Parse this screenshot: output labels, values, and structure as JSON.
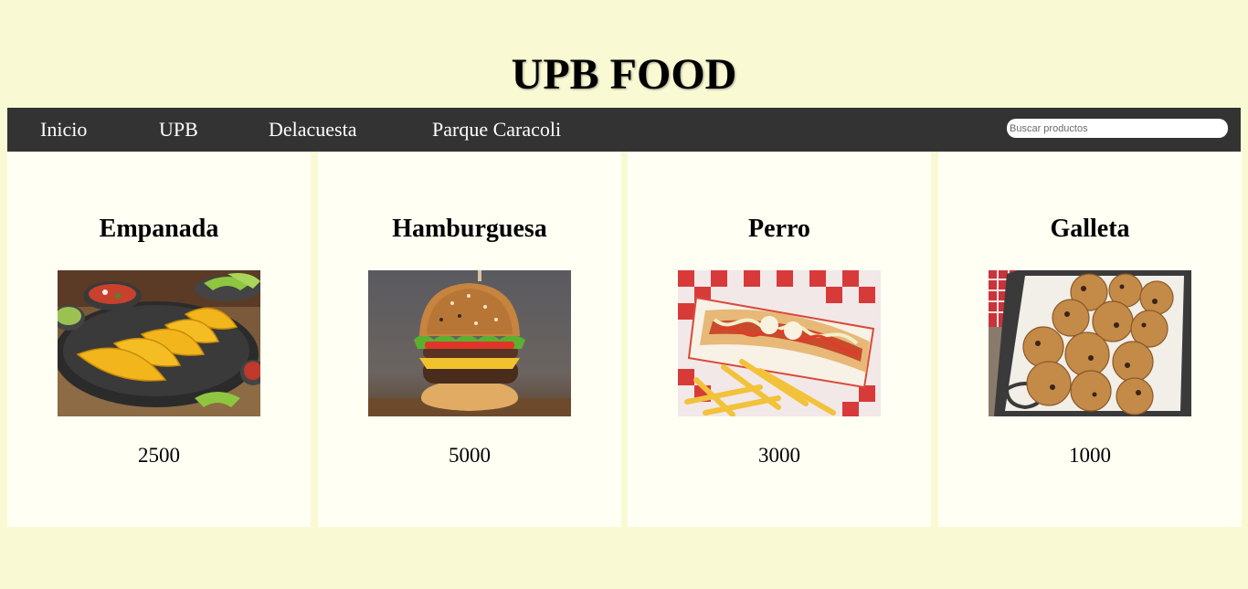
{
  "header": {
    "title": "UPB FOOD"
  },
  "nav": {
    "items": [
      {
        "label": "Inicio"
      },
      {
        "label": "UPB"
      },
      {
        "label": "Delacuesta"
      },
      {
        "label": "Parque Caracoli"
      }
    ],
    "search_placeholder": "Buscar productos",
    "search_value": ""
  },
  "products": [
    {
      "name": "Empanada",
      "price": "2500",
      "image": "empanadas-plate-image"
    },
    {
      "name": "Hamburguesa",
      "price": "5000",
      "image": "hamburger-image"
    },
    {
      "name": "Perro",
      "price": "3000",
      "image": "hotdog-fries-image"
    },
    {
      "name": "Galleta",
      "price": "1000",
      "image": "cookies-tray-image"
    }
  ],
  "colors": {
    "page_background": "#f9f9d4",
    "nav_background": "#333333",
    "card_background": "#fffff4",
    "nav_text": "#ffffff"
  }
}
